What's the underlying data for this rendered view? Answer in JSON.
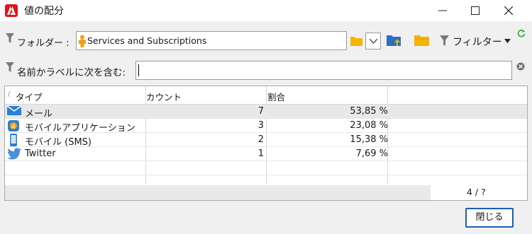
{
  "window": {
    "title": "値の配分",
    "min_icon": "minimize-icon",
    "max_icon": "maximize-icon",
    "close_icon": "close-icon"
  },
  "toolbar": {
    "folder_label": "フォルダー :",
    "folder_value": "Services and Subscriptions",
    "filter_label": "フィルター",
    "search_label": "名前かラベルに次を含む:",
    "search_value": ""
  },
  "table": {
    "columns": [
      "タイプ",
      "カウント",
      "割合"
    ],
    "rows": [
      {
        "icon": "mail-icon",
        "type": "メール",
        "count": "7",
        "percent": "53,85 %"
      },
      {
        "icon": "mobile-app-icon",
        "type": "モバイルアプリケーション",
        "count": "3",
        "percent": "23,08 %"
      },
      {
        "icon": "mobile-phone-icon",
        "type": "モバイル (SMS)",
        "count": "2",
        "percent": "15,38 %"
      },
      {
        "icon": "twitter-icon",
        "type": "Twitter",
        "count": "1",
        "percent": "7,69 %"
      }
    ],
    "counter": "4 / ?"
  },
  "buttons": {
    "close": "閉じる"
  },
  "colors": {
    "accent": "#1a5fb4",
    "brand": "#e0151b",
    "folder": "#f4b400",
    "refresh": "#3cb043"
  }
}
